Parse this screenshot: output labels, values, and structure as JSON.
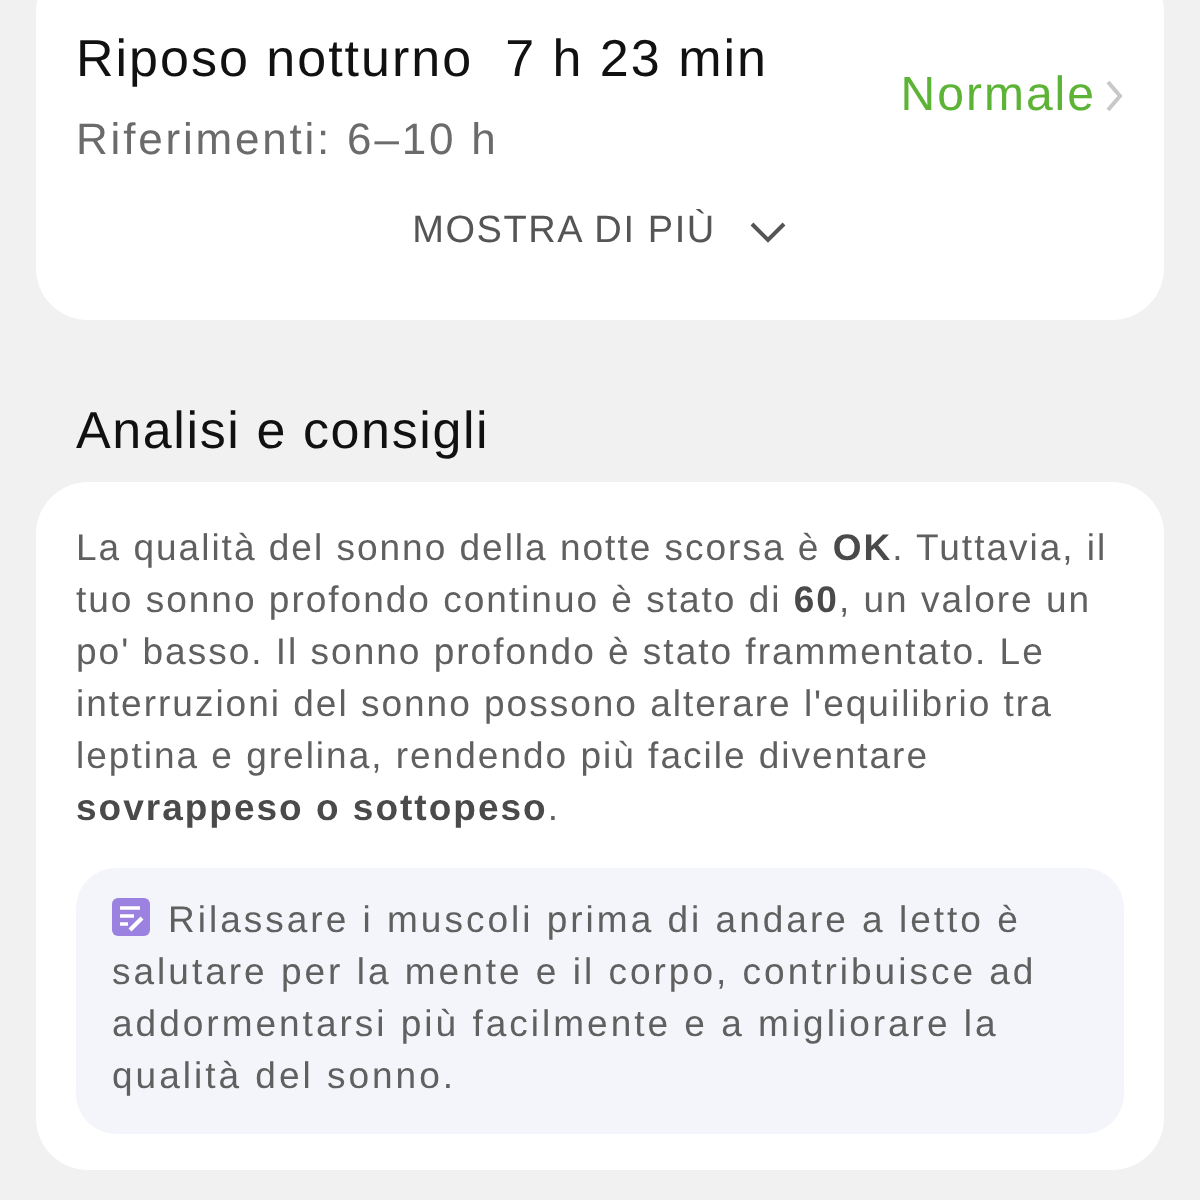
{
  "sleep_card": {
    "title": "Riposo notturno",
    "duration": "7 h 23 min",
    "reference": "Riferimenti: 6–10 h",
    "status": "Normale",
    "show_more": "MOSTRA DI PIÙ"
  },
  "analysis": {
    "heading": "Analisi e consigli",
    "text": "La qualità del sonno della notte scorsa è **OK**. Tuttavia, il tuo sonno profondo continuo è stato di **60**, un valore un po' basso. Il sonno profondo è stato frammentato. Le interruzioni del sonno possono alterare l'equilibrio tra leptina e grelina, rendendo più facile diventare **sovrappeso o sottopeso**.",
    "tip": "Rilassare i muscoli prima di andare a letto è salutare per la mente e il corpo, contribuisce ad addormentarsi più facilmente e a migliorare la qualità del sonno."
  }
}
